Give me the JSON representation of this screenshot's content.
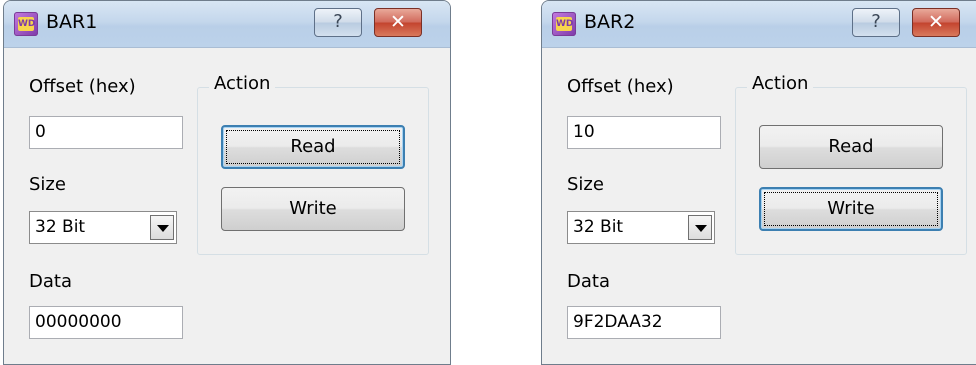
{
  "windows": [
    {
      "title": "BAR1",
      "app_icon_text": "WD",
      "help_label": "?",
      "close_label": "✕",
      "offset_label": "Offset (hex)",
      "offset_value": "0",
      "size_label": "Size",
      "size_value": "32 Bit",
      "data_label": "Data",
      "data_value": "00000000",
      "action_label": "Action",
      "read_label": "Read",
      "write_label": "Write",
      "focused_button": "read"
    },
    {
      "title": "BAR2",
      "app_icon_text": "WD",
      "help_label": "?",
      "close_label": "✕",
      "offset_label": "Offset (hex)",
      "offset_value": "10",
      "size_label": "Size",
      "size_value": "32 Bit",
      "data_label": "Data",
      "data_value": "9F2DAA32",
      "action_label": "Action",
      "read_label": "Read",
      "write_label": "Write",
      "focused_button": "write"
    }
  ]
}
